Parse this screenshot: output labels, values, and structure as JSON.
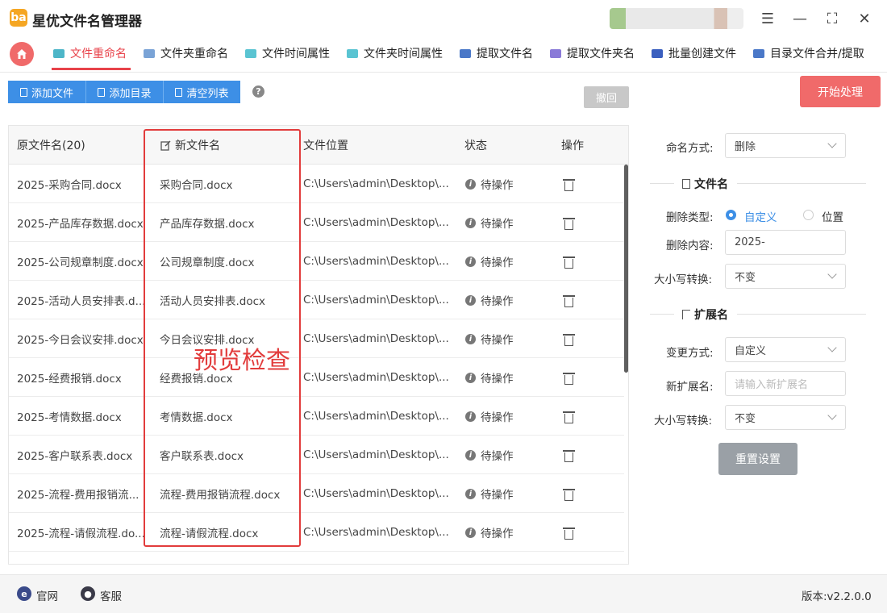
{
  "app": {
    "logo": "ba",
    "title": "星优文件名管理器"
  },
  "tabs": [
    "文件重命名",
    "文件夹重命名",
    "文件时间属性",
    "文件夹时间属性",
    "提取文件名",
    "提取文件夹名",
    "批量创建文件",
    "目录文件合并/提取"
  ],
  "toolbar": {
    "add_file": "添加文件",
    "add_dir": "添加目录",
    "clear": "清空列表",
    "help": "?",
    "undo": "撤回",
    "start": "开始处理"
  },
  "table": {
    "headers": [
      "原文件名(20)",
      "新文件名",
      "文件位置",
      "状态",
      "操作"
    ],
    "rows": [
      {
        "orig": "2025-采购合同.docx",
        "new": "采购合同.docx",
        "loc": "C:\\Users\\admin\\Desktop\\...",
        "status": "待操作"
      },
      {
        "orig": "2025-产品库存数据.docx",
        "new": "产品库存数据.docx",
        "loc": "C:\\Users\\admin\\Desktop\\...",
        "status": "待操作"
      },
      {
        "orig": "2025-公司规章制度.docx",
        "new": "公司规章制度.docx",
        "loc": "C:\\Users\\admin\\Desktop\\...",
        "status": "待操作"
      },
      {
        "orig": "2025-活动人员安排表.d...",
        "new": "活动人员安排表.docx",
        "loc": "C:\\Users\\admin\\Desktop\\...",
        "status": "待操作"
      },
      {
        "orig": "2025-今日会议安排.docx",
        "new": "今日会议安排.docx",
        "loc": "C:\\Users\\admin\\Desktop\\...",
        "status": "待操作"
      },
      {
        "orig": "2025-经费报销.docx",
        "new": "经费报销.docx",
        "loc": "C:\\Users\\admin\\Desktop\\...",
        "status": "待操作"
      },
      {
        "orig": "2025-考情数据.docx",
        "new": "考情数据.docx",
        "loc": "C:\\Users\\admin\\Desktop\\...",
        "status": "待操作"
      },
      {
        "orig": "2025-客户联系表.docx",
        "new": "客户联系表.docx",
        "loc": "C:\\Users\\admin\\Desktop\\...",
        "status": "待操作"
      },
      {
        "orig": "2025-流程-费用报销流...",
        "new": "流程-费用报销流程.docx",
        "loc": "C:\\Users\\admin\\Desktop\\...",
        "status": "待操作"
      },
      {
        "orig": "2025-流程-请假流程.do...",
        "new": "流程-请假流程.docx",
        "loc": "C:\\Users\\admin\\Desktop\\...",
        "status": "待操作"
      }
    ]
  },
  "annotation": "预览检查",
  "panel": {
    "naming_label": "命名方式:",
    "naming_value": "删除",
    "filename_section": "文件名",
    "delete_type_label": "删除类型:",
    "opt_custom": "自定义",
    "opt_position": "位置",
    "delete_content_label": "删除内容:",
    "delete_content_value": "2025-",
    "case_label": "大小写转换:",
    "case_value": "不变",
    "ext_section": "扩展名",
    "change_label": "变更方式:",
    "change_value": "自定义",
    "new_ext_label": "新扩展名:",
    "new_ext_placeholder": "请输入新扩展名",
    "ext_case_label": "大小写转换:",
    "ext_case_value": "不变",
    "reset": "重置设置"
  },
  "footer": {
    "website": "官网",
    "support": "客服",
    "version": "版本:v2.2.0.0"
  },
  "colors": {
    "accent": "#3d8fe6",
    "active_tab": "#e8424a",
    "start": "#f06a6a",
    "annotation": "#e23c3c"
  }
}
